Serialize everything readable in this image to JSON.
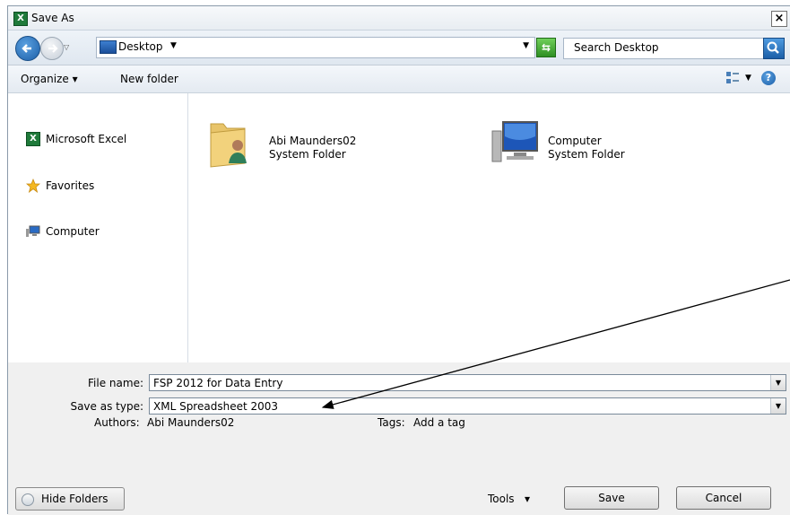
{
  "window": {
    "title": "Save As",
    "close_glyph": "×"
  },
  "nav": {
    "address": "Desktop",
    "search_placeholder": "Search Desktop"
  },
  "toolbar": {
    "organize": "Organize",
    "new_folder": "New folder",
    "help_glyph": "?"
  },
  "sidebar": {
    "items": [
      {
        "label": "Microsoft Excel",
        "icon": "excel-icon"
      },
      {
        "label": "Favorites",
        "icon": "star-icon"
      },
      {
        "label": "Computer",
        "icon": "computer-icon"
      }
    ]
  },
  "files": [
    {
      "name": "Abi Maunders02",
      "type": "System Folder",
      "icon": "user-folder-icon"
    },
    {
      "name": "Computer",
      "type": "System Folder",
      "icon": "computer-icon"
    }
  ],
  "form": {
    "file_name_label": "File name:",
    "file_name_value": "FSP 2012 for Data Entry",
    "save_type_label": "Save as type:",
    "save_type_value": "XML Spreadsheet 2003",
    "authors_label": "Authors:",
    "authors_value": "Abi Maunders02",
    "tags_label": "Tags:",
    "tags_value": "Add a tag"
  },
  "footer": {
    "hide_folders": "Hide Folders",
    "tools": "Tools",
    "save": "Save",
    "cancel": "Cancel"
  },
  "colors": {
    "accent": "#1c5fa8",
    "excel_green": "#1f7a3a",
    "folder": "#e8c46a"
  }
}
